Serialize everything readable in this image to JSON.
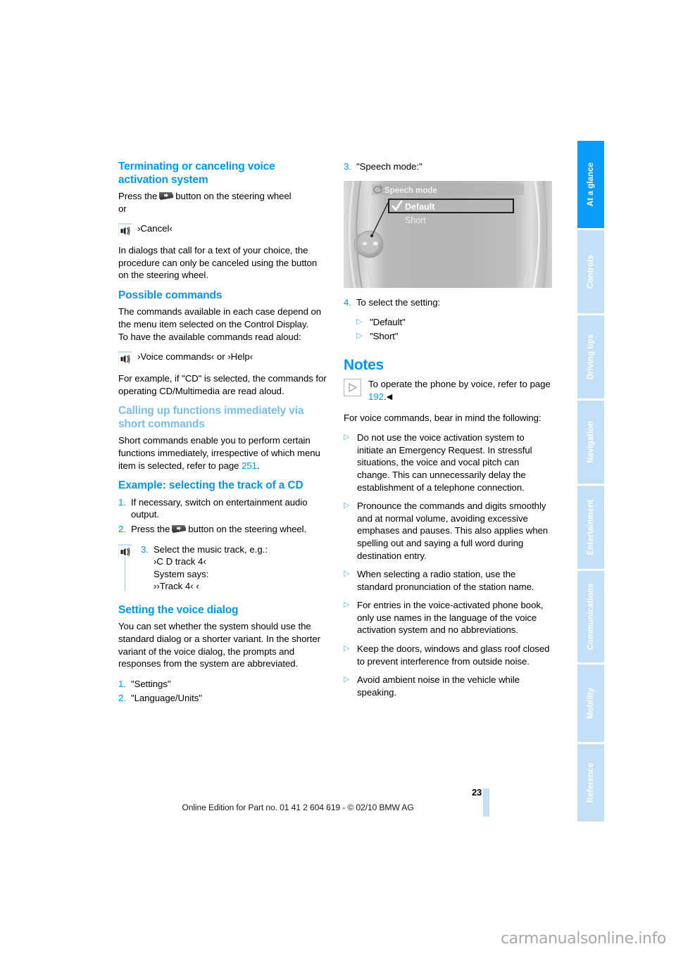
{
  "document": {
    "page_number": "23",
    "footer_text": "Online Edition for Part no. 01 41 2 604 619 - © 02/10 BMW AG",
    "watermark": "carmanualsonline.info"
  },
  "sidebar": {
    "tabs": [
      {
        "label": "At a glance",
        "active": true
      },
      {
        "label": "Controls",
        "active": false
      },
      {
        "label": "Driving tips",
        "active": false
      },
      {
        "label": "Navigation",
        "active": false
      },
      {
        "label": "Entertainment",
        "active": false
      },
      {
        "label": "Communications",
        "active": false
      },
      {
        "label": "Mobility",
        "active": false
      },
      {
        "label": "Reference",
        "active": false
      }
    ],
    "active_color": "#0b9bfb",
    "inactive_color": "#c3e0f7"
  },
  "left_column": {
    "s1": {
      "heading": "Terminating or canceling voice activation system",
      "para1_a": "Press the",
      "para1_b": "button on the steering wheel",
      "or": "or",
      "voice_cancel": "›Cancel‹",
      "para2": "In dialogs that call for a text of your choice, the procedure can only be canceled using the button on the steering wheel."
    },
    "s2": {
      "heading": "Possible commands",
      "para1": "The commands available in each case depend on the menu item selected on the Control Display.",
      "para2": "To have the available commands read aloud:",
      "voice_help": "›Voice commands‹  or ›Help‹",
      "para3": "For example, if \"CD\" is selected, the commands for operating CD/Multimedia are read aloud."
    },
    "s3": {
      "heading": "Calling up functions immediately via short commands",
      "para_a": "Short commands enable you to perform certain functions immediately, irrespective of which menu item is selected, refer to page ",
      "para_ref": "251",
      "para_b": "."
    },
    "s4": {
      "heading": "Example: selecting the track of a CD",
      "step1_num": "1.",
      "step1_text": "If necessary, switch on entertainment audio output.",
      "step2_num": "2.",
      "step2_a": "Press the",
      "step2_b": "button on the steering wheel.",
      "step3_num": "3.",
      "step3_l1": "Select the music track, e.g.:",
      "step3_l2": "›C D track 4‹",
      "step3_l3": "System says:",
      "step3_l4": "››Track 4‹ ‹"
    },
    "s5": {
      "heading": "Setting the voice dialog",
      "para1": "You can set whether the system should use the standard dialog or a shorter variant. In the shorter variant of the voice dialog, the prompts and responses from the system are abbreviated.",
      "step1_num": "1.",
      "step1_text": "\"Settings\"",
      "step2_num": "2.",
      "step2_text": "\"Language/Units\""
    }
  },
  "right_column": {
    "step3_num": "3.",
    "step3_text": "\"Speech mode:\"",
    "figure": {
      "title": "Speech mode",
      "options": [
        {
          "label": "Default",
          "checked": true
        },
        {
          "label": "Short",
          "checked": false
        }
      ]
    },
    "step4_num": "4.",
    "step4_text": "To select the setting:",
    "step4_options": [
      "\"Default\"",
      "\"Short\""
    ],
    "notes": {
      "heading": "Notes",
      "note_a": "To operate the phone by voice, refer to page ",
      "note_ref": "192",
      "note_b": ".",
      "intro": "For voice commands, bear in mind the following:",
      "bullets": [
        "Do not use the voice activation system to initiate an Emergency Request. In stressful situations, the voice and vocal pitch can change. This can unnecessarily delay the establishment of a telephone connection.",
        "Pronounce the commands and digits smoothly and at normal volume, avoiding excessive emphases and pauses. This also applies when spelling out and saying a full word during destination entry.",
        "When selecting a radio station, use the standard pronunciation of the station name.",
        "For entries in the voice-activated phone book, only use names in the language of the voice activation system and no abbreviations.",
        "Keep the doors, windows and glass roof closed to prevent interference from outside noise.",
        "Avoid ambient noise in the vehicle while speaking."
      ]
    }
  },
  "colors": {
    "heading_blue": "#0096f0",
    "heading_light_blue": "#77bdee",
    "bullet_blue": "#4fb3f2"
  }
}
